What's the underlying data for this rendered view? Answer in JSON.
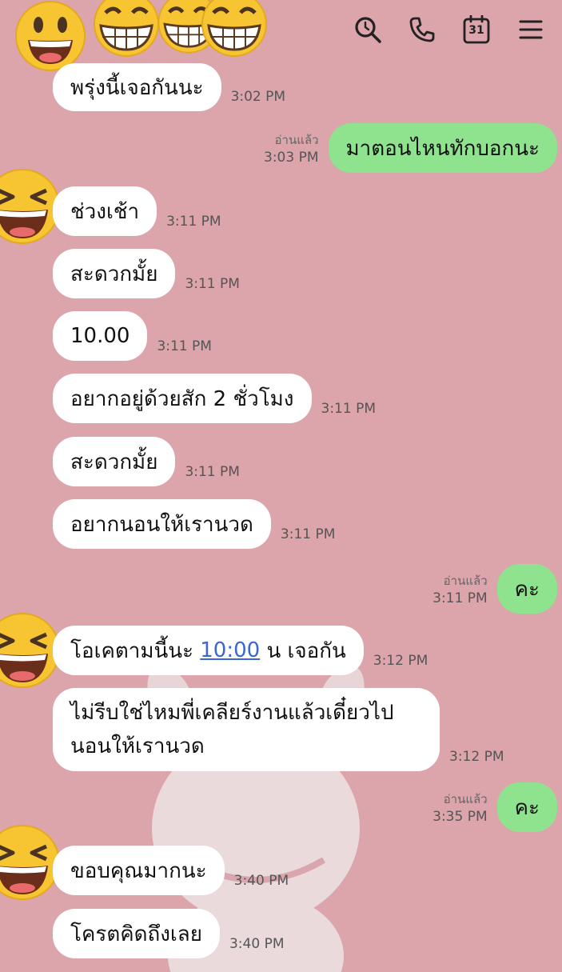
{
  "header": {
    "calendar_day": "31"
  },
  "messages": [
    {
      "text": "พรุ่งนี้เจอกันนะ",
      "time": "3:02 PM"
    },
    {
      "text": "มาตอนไหนทักบอกนะ",
      "time": "3:03 PM",
      "read": "อ่านแล้ว"
    },
    {
      "text": "ช่วงเช้า",
      "time": "3:11 PM"
    },
    {
      "text": "สะดวกมั้ย",
      "time": "3:11 PM"
    },
    {
      "text": "10.00",
      "time": "3:11 PM"
    },
    {
      "text": "อยากอยู่ด้วยสัก 2 ชั่วโมง",
      "time": "3:11 PM"
    },
    {
      "text": "สะดวกมั้ย",
      "time": "3:11 PM"
    },
    {
      "text": "อยากนอนให้เรานวด",
      "time": "3:11 PM"
    },
    {
      "text": "คะ",
      "time": "3:11 PM",
      "read": "อ่านแล้ว"
    },
    {
      "text_before": "โอเคตามนี้นะ ",
      "link": "10:00",
      "text_after": " น เจอกัน",
      "time": "3:12 PM"
    },
    {
      "line1": "ไม่รีบใช่ไหมพี่เคลียร์งานแล้วเดี๋ยวไป",
      "line2": "นอนให้เรานวด",
      "time": "3:12 PM"
    },
    {
      "text": "คะ",
      "time": "3:35 PM",
      "read": "อ่านแล้ว"
    },
    {
      "text": "ขอบคุณมากนะ",
      "time": "3:40 PM"
    },
    {
      "text": "โครตคิดถึงเลย",
      "time": "3:40 PM"
    }
  ]
}
